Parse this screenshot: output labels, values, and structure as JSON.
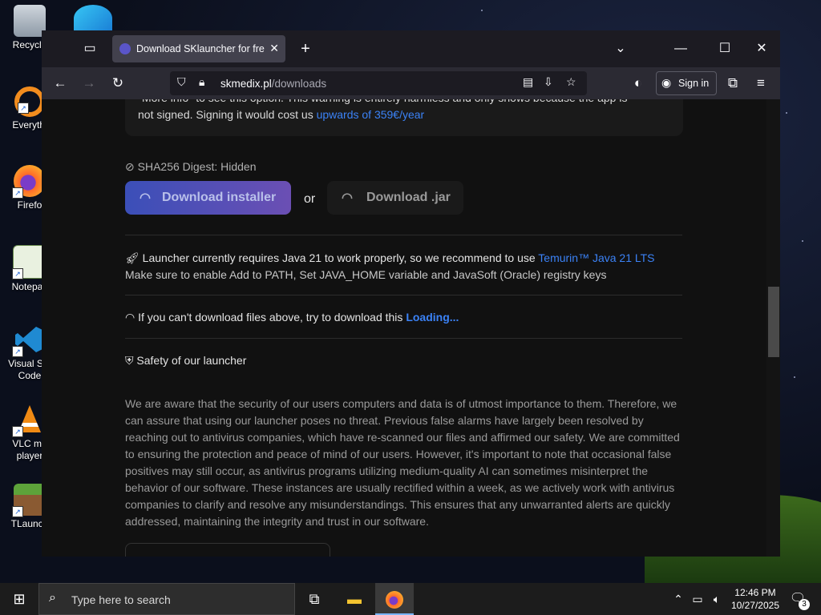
{
  "desktop_icons": [
    {
      "label": "Recycle",
      "icon": "recycle-bin-icon"
    },
    {
      "label": "Everythi",
      "icon": "everything-search-icon"
    },
    {
      "label": "Firefo",
      "icon": "firefox-icon"
    },
    {
      "label": "Notepac",
      "icon": "notepad-icon"
    },
    {
      "label": "Visual Stu Code",
      "icon": "vscode-icon"
    },
    {
      "label": "VLC me player",
      "icon": "vlc-icon"
    },
    {
      "label": "TLaunch",
      "icon": "tlauncher-icon"
    }
  ],
  "browser": {
    "tab_title": "Download SKlauncher for free |",
    "url_host": "skmedix.pl",
    "url_path": "/downloads",
    "sign_in": "Sign in"
  },
  "page": {
    "warning_line1": "\"More info\" to see this option. This warning is entirely harmless and only shows because the app is",
    "warning_line2_a": "not signed. Signing it would cost us ",
    "warning_line2_link": "upwards of 359€/year",
    "sha": "SHA256 Digest: Hidden",
    "download_installer": "Download installer",
    "or": "or",
    "download_jar": "Download .jar",
    "java_req_a": "Launcher currently requires Java 21 to work properly, so we recommend to use ",
    "java_req_link": "Temurin™ Java 21 LTS",
    "java_path": "Make sure to enable Add to PATH, Set JAVA_HOME variable and JavaSoft (Oracle) registry keys",
    "alt_dl_a": "If you can't download files above, try to download this ",
    "alt_dl_link": "Loading...",
    "safety_title": "Safety of our launcher",
    "safety_paragraph": "We are aware that the security of our users computers and data is of utmost importance to them. Therefore, we can assure that using our launcher poses no threat. Previous false alarms have largely been resolved by reaching out to antivirus companies, which have re-scanned our files and affirmed our safety. We are committed to ensuring the protection and peace of mind of our users. However, it's important to note that occasional false positives may still occur, as antivirus programs utilizing medium-quality AI can sometimes misinterpret the behavior of our software. These instances are usually rectified within a week, as we actively work with antivirus companies to clarify and resolve any misunderstandings. This ensures that any unwarranted alerts are quickly addressed, maintaining the integrity and trust in our software."
  },
  "taskbar": {
    "search_placeholder": "Type here to search",
    "time": "12:46 PM",
    "date": "10/27/2025",
    "notification_count": "3"
  },
  "colors": {
    "link": "#3b82f6",
    "accent_start": "#3b4fb8",
    "accent_end": "#6b4fb4"
  }
}
